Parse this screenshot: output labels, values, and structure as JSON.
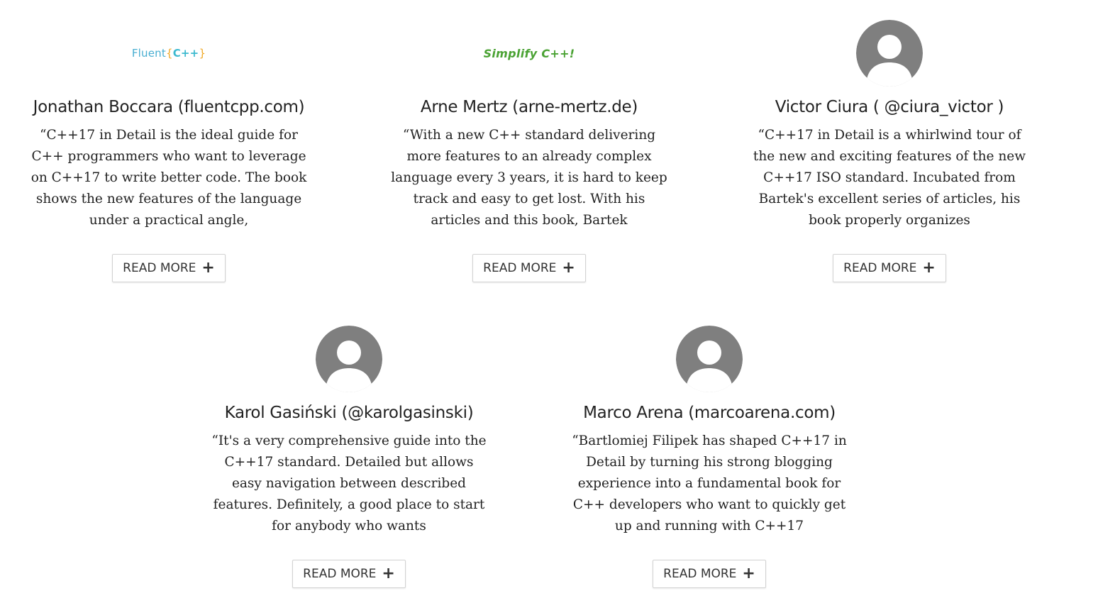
{
  "testimonials": [
    {
      "logo": {
        "type": "text-logo",
        "word": "Fluent",
        "open": "{",
        "code": "C++",
        "close": "}"
      },
      "name": "Jonathan Boccara (fluentcpp.com)",
      "quote": "“C++17 in Detail is the ideal guide for C++ programmers who want to leverage on C++17 to write better code. The book shows the new features of the language under a practical angle,",
      "button": "READ MORE",
      "button_icon": "plus-icon"
    },
    {
      "logo": {
        "type": "text-logo",
        "text": "Simplify C++!"
      },
      "name": "Arne Mertz (arne-mertz.de)",
      "quote": "“With a new C++ standard delivering more features to an already complex language every 3 years, it is hard to keep track and easy to get lost. With his articles and this book, Bartek",
      "button": "READ MORE",
      "button_icon": "plus-icon"
    },
    {
      "logo": {
        "type": "avatar-placeholder"
      },
      "name": "Victor Ciura ( @ciura_victor )",
      "quote": "“C++17 in Detail is a whirlwind tour of the new and exciting features of the new C++17 ISO standard. Incubated from Bartek's excellent series of articles, his book properly organizes",
      "button": "READ MORE",
      "button_icon": "plus-icon"
    },
    {
      "logo": {
        "type": "avatar-placeholder"
      },
      "name": "Karol Gasiński (@karolgasinski)",
      "quote": "“It's a very comprehensive guide into the C++17 standard. Detailed but allows easy navigation between described features. Definitely, a good place to start for anybody who wants",
      "button": "READ MORE",
      "button_icon": "plus-icon"
    },
    {
      "logo": {
        "type": "avatar-placeholder"
      },
      "name": "Marco Arena (marcoarena.com)",
      "quote": "“Bartlomiej Filipek has shaped C++17 in Detail by turning his strong blogging experience into a fundamental book for C++ developers who want to quickly get up and running with C++17",
      "button": "READ MORE",
      "button_icon": "plus-icon"
    }
  ],
  "colors": {
    "avatar_gray": "#7f7f7f",
    "fluent_blue": "#48aed1",
    "fluent_orange": "#f0a825",
    "simplify_green": "#4aa233"
  }
}
